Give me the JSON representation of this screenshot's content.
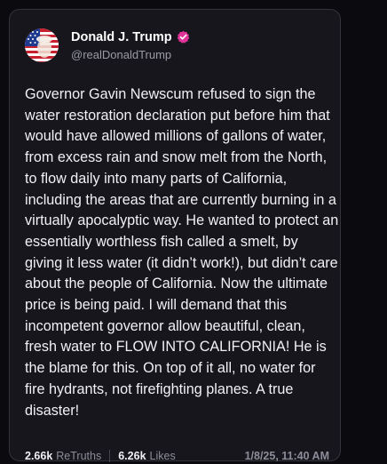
{
  "post": {
    "author": {
      "display_name": "Donald J. Trump",
      "handle": "@realDonaldTrump",
      "verified_icon": "verified-badge-icon",
      "verified_color": "#e0339a"
    },
    "text": "Governor Gavin Newscum refused to sign the water restoration declaration put before him that would have allowed millions of gallons of water, from excess rain and snow melt from the North, to flow daily into many parts of California, including the areas that are currently burning in a virtually apocalyptic way. He wanted to protect an essentially worthless fish called a smelt, by giving it less water (it didn’t work!), but didn’t care about the people of California. Now the ultimate price is being paid. I will demand that this incompetent governor allow beautiful, clean, fresh water to FLOW INTO CALIFORNIA! He is the blame for this. On top of it all, no water for fire hydrants, not firefighting planes. A true disaster!",
    "stats": {
      "retruths_count": "2.66k",
      "retruths_label": "ReTruths",
      "likes_count": "6.26k",
      "likes_label": "Likes"
    },
    "timestamp": "1/8/25, 11:40 AM"
  },
  "colors": {
    "background": "#0b0b0f",
    "card": "#16161c",
    "text": "#f1f1f4",
    "muted": "#8d8d99"
  }
}
